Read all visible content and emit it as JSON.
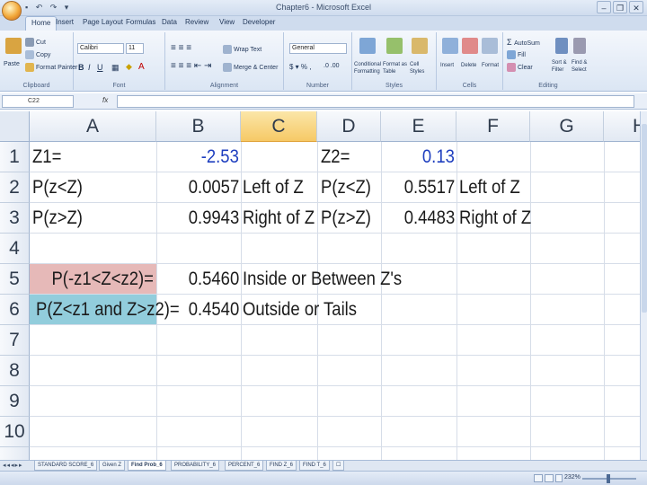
{
  "window": {
    "title": "Chapter6 - Microsoft Excel",
    "qat": "▪ ↶ ↷ ▾",
    "controls": [
      "–",
      "❐",
      "✕"
    ]
  },
  "ribbon_tabs": [
    "Home",
    "Insert",
    "Page Layout",
    "Formulas",
    "Data",
    "Review",
    "View",
    "Developer"
  ],
  "ribbon": {
    "clipboard": {
      "name": "Clipboard",
      "paste": "Paste",
      "cut": "Cut",
      "copy": "Copy",
      "format_painter": "Format Painter"
    },
    "font": {
      "name": "Font",
      "family": "Calibri",
      "size": "11"
    },
    "alignment": {
      "name": "Alignment",
      "wrap": "Wrap Text",
      "merge": "Merge & Center"
    },
    "number": {
      "name": "Number",
      "format": "General"
    },
    "styles": {
      "name": "Styles",
      "conditional": "Conditional Formatting",
      "format_table": "Format as Table",
      "cell_styles": "Cell Styles"
    },
    "cells": {
      "name": "Cells",
      "insert": "Insert",
      "delete": "Delete",
      "format": "Format"
    },
    "editing": {
      "name": "Editing",
      "autosum": "AutoSum",
      "fill": "Fill",
      "clear": "Clear",
      "sort": "Sort & Filter",
      "find": "Find & Select"
    }
  },
  "formula_bar": {
    "name_box": "C22",
    "fx": "fx",
    "value": ""
  },
  "columns": [
    "A",
    "B",
    "C",
    "D",
    "E",
    "F",
    "G",
    "H"
  ],
  "selected_column": "C",
  "rows": [
    "1",
    "2",
    "3",
    "4",
    "5",
    "6",
    "7",
    "8",
    "9",
    "10"
  ],
  "cells": {
    "A1": "Z1=",
    "B1": "-2.53",
    "D1": "Z2=",
    "E1": "0.13",
    "A2": "P(z<Z)",
    "B2": "0.0057",
    "C2": "Left of Z",
    "D2": "P(z<Z)",
    "E2": "0.5517",
    "F2": "Left of Z",
    "A3": "P(z>Z)",
    "B3": "0.9943",
    "C3": "Right of Z",
    "D3": "P(z>Z)",
    "E3": "0.4483",
    "F3": "Right of Z",
    "A5": "P(-z1<Z<z2)=",
    "B5": "0.5460",
    "C5": "Inside or Between Z's",
    "A6": "P(Z<z1 and Z>z2)=",
    "B6": "0.4540",
    "C6": "Outside or Tails"
  },
  "colors": {
    "pink_fill": "#e6b9b8",
    "teal_fill": "#92cddc",
    "blue_text": "#1f3fbf",
    "selected_header": "#f6c966"
  },
  "sheet_tabs": [
    "STANDARD SCORE_6",
    "Given Z",
    "Find Prob_6",
    "PROBABILITY_6",
    "PERCENT_6",
    "FIND Z_6",
    "FIND T_6"
  ],
  "active_sheet": "Find Prob_6",
  "status": {
    "zoom": "232%"
  }
}
